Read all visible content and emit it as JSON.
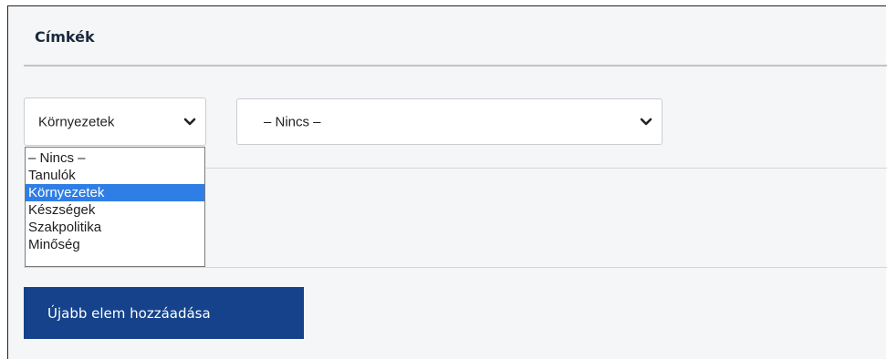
{
  "section": {
    "title": "Címkék"
  },
  "selects": {
    "category": {
      "value": "Környezetek",
      "icon": "chevron-down-icon"
    },
    "subcategory": {
      "value": "– Nincs –",
      "icon": "chevron-down-icon"
    }
  },
  "dropdown": {
    "options": [
      "– Nincs –",
      "Tanulók",
      "Környezetek",
      "Készségek",
      "Szakpolitika",
      "Minőség"
    ],
    "selected_index": 2,
    "highlight_color": "#2f7ee6"
  },
  "actions": {
    "add_label": "Újabb elem hozzáadása",
    "add_color": "#15428b"
  }
}
